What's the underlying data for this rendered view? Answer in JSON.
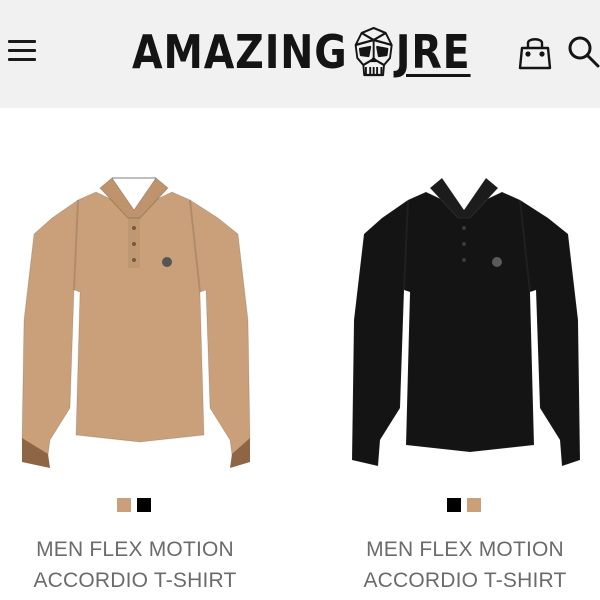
{
  "header": {
    "logo_left": "AMAZING",
    "logo_right": "JRE",
    "icons": [
      "menu-icon",
      "skull-icon",
      "shopping-bag-icon",
      "search-icon"
    ]
  },
  "products": [
    {
      "title_line1": "MEN FLEX MOTION",
      "title_line2": "ACCORDIO T-SHIRT",
      "shirt_color": "#c9a07a",
      "swatches": [
        "#c9a07a",
        "#000000"
      ]
    },
    {
      "title_line1": "MEN FLEX MOTION",
      "title_line2": "ACCORDIO T-SHIRT",
      "shirt_color": "#141414",
      "swatches": [
        "#000000",
        "#c9a07a"
      ]
    }
  ],
  "colors": {
    "header_bg": "#f1f1f1",
    "logo": "#141414",
    "title_text": "#6b6b6b"
  }
}
